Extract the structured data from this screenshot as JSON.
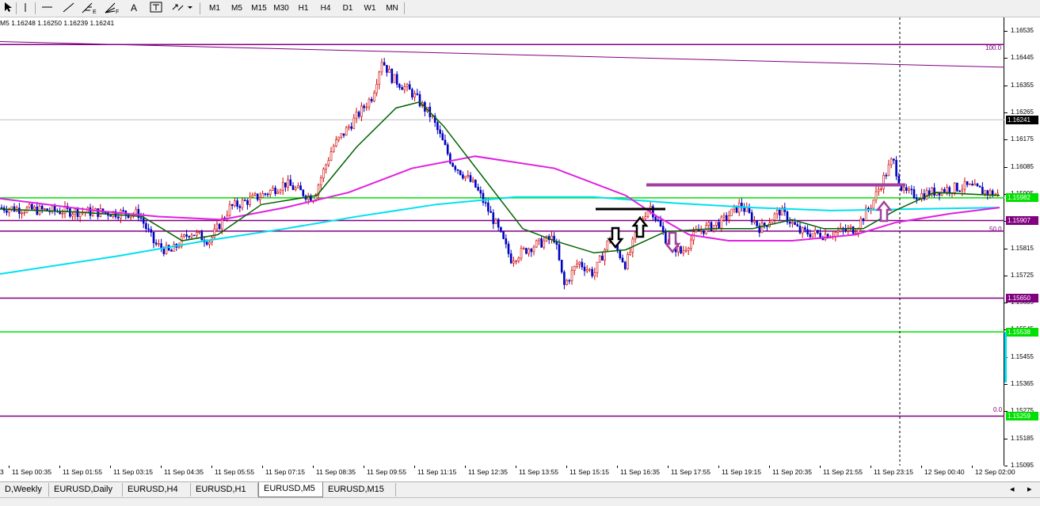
{
  "toolbar": {
    "tools": [
      "cursor-icon",
      "vertical-line-icon",
      "horizontal-line-icon",
      "trendline-icon",
      "fibonacci-icon",
      "fibo-fan-icon",
      "text-icon",
      "text-label-icon",
      "arrows-icon"
    ],
    "fibonacci_label": "E",
    "fibo_fan_label": "F",
    "text_label": "A",
    "timeframes": [
      "M1",
      "M5",
      "M15",
      "M30",
      "H1",
      "H4",
      "D1",
      "W1",
      "MN"
    ]
  },
  "chart_header": {
    "timeframe": "M5",
    "ohlc": "1.16248 1.16250 1.16239 1.16241"
  },
  "y_axis": {
    "ticks": [
      "1.16535",
      "1.16445",
      "1.16355",
      "1.16265",
      "1.16175",
      "1.16085",
      "1.15995",
      "1.15905",
      "1.15815",
      "1.15725",
      "1.15635",
      "1.15545",
      "1.15455",
      "1.15365",
      "1.15275",
      "1.15185",
      "1.15095"
    ],
    "price_tags": [
      {
        "value": "1.16241",
        "bg": "#000000",
        "fg": "#ffffff"
      },
      {
        "value": "1.15982",
        "bg": "#00e000",
        "fg": "#ffffff"
      },
      {
        "value": "1.15907",
        "bg": "#800080",
        "fg": "#ffffff"
      },
      {
        "value": "1.15650",
        "bg": "#800080",
        "fg": "#ffffff"
      },
      {
        "value": "1.15538",
        "bg": "#00e000",
        "fg": "#ffffff"
      },
      {
        "value": "1.15259",
        "bg": "#00e000",
        "fg": "#ffffff"
      }
    ]
  },
  "fib_levels": {
    "top": "100.0",
    "mid": "50.0",
    "bottom": "0.0"
  },
  "x_axis": {
    "first": "3",
    "labels": [
      "11 Sep 00:35",
      "11 Sep 01:55",
      "11 Sep 03:15",
      "11 Sep 04:35",
      "11 Sep 05:55",
      "11 Sep 07:15",
      "11 Sep 08:35",
      "11 Sep 09:55",
      "11 Sep 11:15",
      "11 Sep 12:35",
      "11 Sep 13:55",
      "11 Sep 15:15",
      "11 Sep 16:35",
      "11 Sep 17:55",
      "11 Sep 19:15",
      "11 Sep 20:35",
      "11 Sep 21:55",
      "11 Sep 23:15",
      "12 Sep 00:40",
      "12 Sep 02:00"
    ]
  },
  "tabs": [
    {
      "label": "D,Weekly",
      "active": false
    },
    {
      "label": "EURUSD,Daily",
      "active": false
    },
    {
      "label": "EURUSD,H4",
      "active": false
    },
    {
      "label": "EURUSD,H1",
      "active": false
    },
    {
      "label": "EURUSD,M5",
      "active": true
    },
    {
      "label": "EURUSD,M15",
      "active": false
    }
  ],
  "colors": {
    "bull": "#d00000",
    "bear": "#0000c0",
    "ma_fast": "#006400",
    "ma_mid": "#e020e0",
    "ma_slow": "#00e0f0",
    "support": "#00e000",
    "fib": "#800080",
    "annotation": "#a040a0"
  },
  "chart_data": {
    "type": "candlestick",
    "symbol_timeframe": "M5",
    "y_range": [
      1.15095,
      1.1658
    ],
    "horizontal_levels": [
      {
        "price": 1.1649,
        "color": "#800080"
      },
      {
        "price": 1.15982,
        "color": "#00e000"
      },
      {
        "price": 1.15907,
        "color": "#800080"
      },
      {
        "price": 1.15872,
        "color": "#800080"
      },
      {
        "price": 1.1565,
        "color": "#800080"
      },
      {
        "price": 1.15538,
        "color": "#00e000"
      },
      {
        "price": 1.15259,
        "color": "#800080"
      }
    ],
    "price_path": [
      [
        0,
        1.1595
      ],
      [
        60,
        1.1594
      ],
      [
        120,
        1.15935
      ],
      [
        175,
        1.1593
      ],
      [
        195,
        1.1583
      ],
      [
        215,
        1.158
      ],
      [
        240,
        1.1587
      ],
      [
        265,
        1.1584
      ],
      [
        290,
        1.1595
      ],
      [
        330,
        1.1599
      ],
      [
        360,
        1.1603
      ],
      [
        395,
        1.1598
      ],
      [
        420,
        1.1615
      ],
      [
        450,
        1.1625
      ],
      [
        470,
        1.1632
      ],
      [
        482,
        1.1644
      ],
      [
        495,
        1.1638
      ],
      [
        520,
        1.1633
      ],
      [
        545,
        1.1625
      ],
      [
        570,
        1.161
      ],
      [
        600,
        1.1602
      ],
      [
        625,
        1.159
      ],
      [
        645,
        1.1578
      ],
      [
        670,
        1.1582
      ],
      [
        700,
        1.1585
      ],
      [
        712,
        1.1569
      ],
      [
        730,
        1.1577
      ],
      [
        750,
        1.1573
      ],
      [
        770,
        1.1585
      ],
      [
        790,
        1.1576
      ],
      [
        808,
        1.159
      ],
      [
        820,
        1.1596
      ],
      [
        840,
        1.1585
      ],
      [
        860,
        1.158
      ],
      [
        880,
        1.1587
      ],
      [
        910,
        1.159
      ],
      [
        935,
        1.1596
      ],
      [
        960,
        1.1588
      ],
      [
        985,
        1.1594
      ],
      [
        1010,
        1.1587
      ],
      [
        1040,
        1.1586
      ],
      [
        1080,
        1.1588
      ],
      [
        1100,
        1.1596
      ],
      [
        1127,
        1.1611
      ],
      [
        1140,
        1.16
      ],
      [
        1160,
        1.1599
      ],
      [
        1190,
        1.1601
      ],
      [
        1220,
        1.1602
      ],
      [
        1262,
        1.1599
      ]
    ],
    "ma_fast": [
      [
        0,
        1.15945
      ],
      [
        100,
        1.15935
      ],
      [
        180,
        1.1592
      ],
      [
        230,
        1.1584
      ],
      [
        275,
        1.1586
      ],
      [
        330,
        1.1596
      ],
      [
        400,
        1.1599
      ],
      [
        450,
        1.1615
      ],
      [
        500,
        1.1628
      ],
      [
        530,
        1.163
      ],
      [
        560,
        1.1622
      ],
      [
        610,
        1.1605
      ],
      [
        660,
        1.1588
      ],
      [
        700,
        1.1584
      ],
      [
        750,
        1.158
      ],
      [
        790,
        1.1581
      ],
      [
        840,
        1.1587
      ],
      [
        900,
        1.1588
      ],
      [
        950,
        1.1588
      ],
      [
        1000,
        1.1591
      ],
      [
        1040,
        1.1588
      ],
      [
        1090,
        1.1588
      ],
      [
        1130,
        1.1594
      ],
      [
        1180,
        1.16
      ],
      [
        1262,
        1.1599
      ]
    ],
    "ma_mid": [
      [
        0,
        1.1598
      ],
      [
        120,
        1.1594
      ],
      [
        200,
        1.1592
      ],
      [
        280,
        1.1591
      ],
      [
        360,
        1.1595
      ],
      [
        440,
        1.16
      ],
      [
        520,
        1.1608
      ],
      [
        600,
        1.1612
      ],
      [
        700,
        1.1608
      ],
      [
        790,
        1.1599
      ],
      [
        830,
        1.1592
      ],
      [
        870,
        1.1586
      ],
      [
        920,
        1.1584
      ],
      [
        1000,
        1.1584
      ],
      [
        1080,
        1.1586
      ],
      [
        1130,
        1.159
      ],
      [
        1200,
        1.1593
      ],
      [
        1262,
        1.1595
      ]
    ],
    "ma_slow": [
      [
        0,
        1.1573
      ],
      [
        150,
        1.1579
      ],
      [
        260,
        1.1584
      ],
      [
        360,
        1.1588
      ],
      [
        450,
        1.1592
      ],
      [
        550,
        1.1596
      ],
      [
        650,
        1.15985
      ],
      [
        750,
        1.15985
      ],
      [
        850,
        1.15965
      ],
      [
        950,
        1.1595
      ],
      [
        1050,
        1.1594
      ],
      [
        1150,
        1.15945
      ],
      [
        1262,
        1.1595
      ]
    ]
  }
}
